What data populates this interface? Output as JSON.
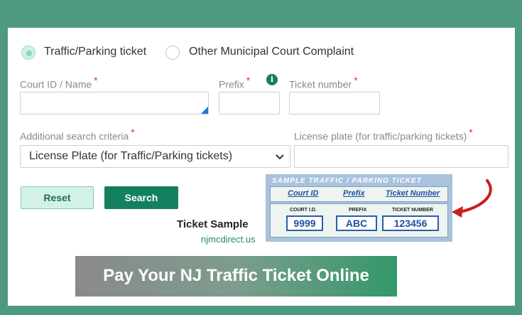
{
  "radios": {
    "traffic": {
      "label": "Traffic/Parking ticket",
      "selected": true
    },
    "municipal": {
      "label": "Other Municipal Court Complaint",
      "selected": false
    }
  },
  "fields": {
    "court": {
      "label": "Court ID / Name",
      "required": "*",
      "value": ""
    },
    "prefix": {
      "label": "Prefix",
      "required": "*",
      "info_icon": "i",
      "value": ""
    },
    "ticket_number": {
      "label": "Ticket number",
      "required": "*",
      "value": ""
    },
    "criteria": {
      "label": "Additional search criteria",
      "required": "*",
      "selected": "License Plate (for Traffic/Parking tickets)"
    },
    "plate": {
      "label": "License plate (for traffic/parking tickets)",
      "required": "*",
      "value": ""
    }
  },
  "buttons": {
    "reset": "Reset",
    "search": "Search"
  },
  "sample": {
    "caption": "Ticket Sample",
    "site": "njmcdirect.us",
    "header": "SAMPLE TRAFFIC / PARKING TICKET",
    "columns": [
      "Court ID",
      "Prefix",
      "Ticket Number"
    ],
    "small_labels": [
      "COURT I.D.",
      "PREFIX",
      "TICKET NUMBER"
    ],
    "values": [
      "9999",
      "ABC",
      "123456"
    ]
  },
  "banner": "Pay Your NJ Traffic Ticket Online",
  "colors": {
    "accent": "#13805f",
    "background": "#4e9a80",
    "required": "#d63a3a",
    "arrow": "#d42020"
  }
}
